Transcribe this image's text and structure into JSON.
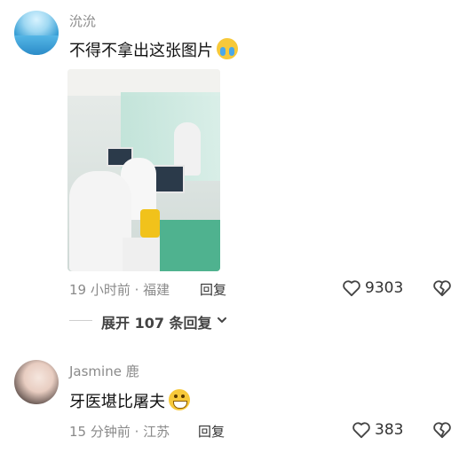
{
  "comments": [
    {
      "username": "沇沇",
      "text": "不得不拿出这张图片",
      "emoji": "crying-laughing-emoji",
      "meta": "19 小时前 · 福建",
      "reply_label": "回复",
      "likes": "9303"
    },
    {
      "username": "Jasmine 鹿",
      "text": "牙医堪比屠夫",
      "emoji": "grinning-emoji",
      "meta": "15 分钟前 · 江苏",
      "reply_label": "回复",
      "likes": "383"
    }
  ],
  "expand_replies": "展开 107 条回复",
  "colors": {
    "text_primary": "#111111",
    "text_secondary": "#8a8a8a",
    "icon": "#444444"
  }
}
